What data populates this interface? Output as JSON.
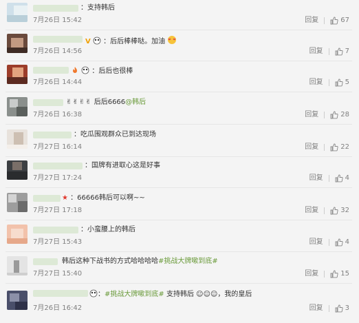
{
  "comments": [
    {
      "text": "：支持韩后",
      "date": "7月26日 15:42",
      "reply": "回复",
      "likes": "67"
    },
    {
      "text": "：后后棒棒哒。加油",
      "date": "7月26日 14:56",
      "reply": "回复",
      "likes": "7"
    },
    {
      "text": "：后后也很棒",
      "date": "7月26日 14:44",
      "reply": "回复",
      "likes": "5"
    },
    {
      "text": "后后6666",
      "mention": "@韩后",
      "date": "7月26日 16:38",
      "reply": "回复",
      "likes": "28"
    },
    {
      "text": "：吃瓜围观群众已到达现场",
      "date": "7月27日 16:14",
      "reply": "回复",
      "likes": "22"
    },
    {
      "text": "：国牌有进取心这是好事",
      "date": "7月27日 17:24",
      "reply": "回复",
      "likes": "4"
    },
    {
      "text": "：66666韩后可以啊~~",
      "date": "7月27日 17:18",
      "reply": "回复",
      "likes": "32"
    },
    {
      "text": "：小蛮腰上的韩后",
      "date": "7月27日 15:43",
      "reply": "回复",
      "likes": "4"
    },
    {
      "text": "韩后这种下战书的方式哈哈哈哈",
      "hashtag": "#挑战大牌嗽到底#",
      "date": "7月27日 15:40",
      "reply": "回复",
      "likes": "15"
    },
    {
      "text_pre": "：",
      "hashtag": "#挑战大牌嗽到底#",
      "text": " 支持韩后",
      "text_post": "，我的皇后",
      "date": "7月26日 16:42",
      "reply": "回复",
      "likes": "3"
    }
  ]
}
